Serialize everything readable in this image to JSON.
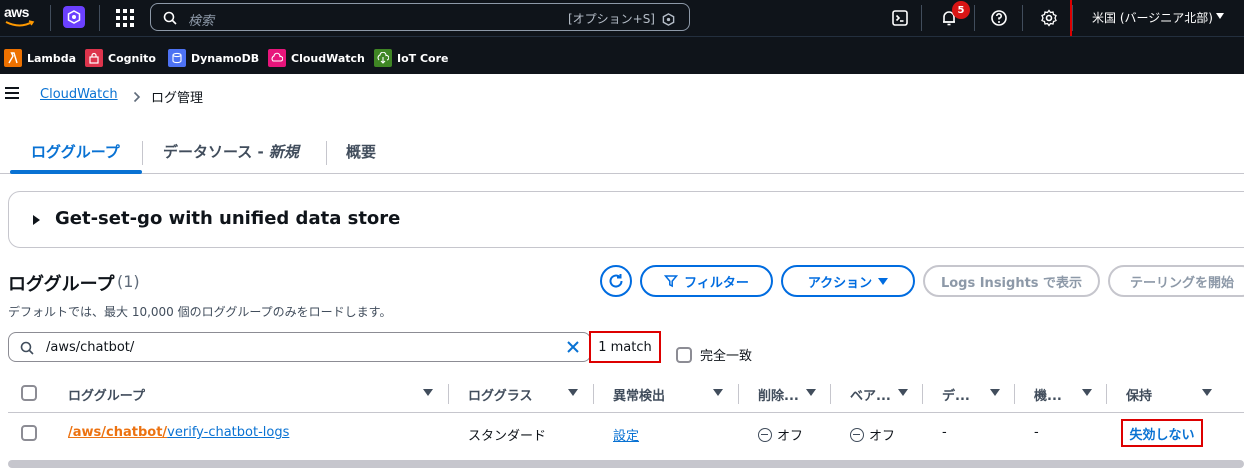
{
  "topnav": {
    "logo_text": "aws",
    "search_placeholder": "検索",
    "search_shortcut": "[オプション+S]",
    "notifications_count": "5",
    "region": "米国 (バージニア北部)",
    "icons": [
      "amazon-q-icon",
      "services-grid-icon",
      "search-icon",
      "cloudshell-icon",
      "bell-icon",
      "help-icon",
      "settings-icon"
    ]
  },
  "favorites": [
    {
      "label": "Lambda",
      "color": "#ed7100"
    },
    {
      "label": "Cognito",
      "color": "#dd344c"
    },
    {
      "label": "DynamoDB",
      "color": "#4d72f3"
    },
    {
      "label": "CloudWatch",
      "color": "#e7157b"
    },
    {
      "label": "IoT Core",
      "color": "#3f8624"
    }
  ],
  "breadcrumb": {
    "root": "CloudWatch",
    "current": "ログ管理"
  },
  "tabs": [
    {
      "label": "ロググループ",
      "active": true
    },
    {
      "label": "データソース - 新規",
      "active": false
    },
    {
      "label": "概要",
      "active": false
    }
  ],
  "promo": {
    "title": "Get-set-go with unified data store"
  },
  "section": {
    "title": "ロググループ",
    "count": "(1)",
    "description": "デフォルトでは、最大 10,000 個のロググループのみをロードします。",
    "buttons": {
      "filter": "フィルター",
      "actions": "アクション",
      "logs_insights": "Logs Insights で表示",
      "tailing": "テーリングを開始"
    }
  },
  "filter": {
    "value": "/aws/chatbot/",
    "match_text": "1 match",
    "exact_match_label": "完全一致"
  },
  "table": {
    "columns": [
      "ロググループ",
      "ロググラス",
      "異常検出",
      "削除...",
      "ベア...",
      "デ...",
      "機...",
      "保持"
    ],
    "rows": [
      {
        "log_group_prefix": "/aws/chatbot/",
        "log_group_suffix": "verify-chatbot-logs",
        "log_class": "スタンダード",
        "anomaly": "設定",
        "deletion": "オフ",
        "bearer": "オフ",
        "data": "-",
        "machine": "-",
        "retention": "失効しない"
      }
    ]
  },
  "colors": {
    "nav_bg": "#0f141a",
    "link": "#0972d3",
    "accent_orange": "#ec7211",
    "highlight_red": "#dd0000"
  }
}
